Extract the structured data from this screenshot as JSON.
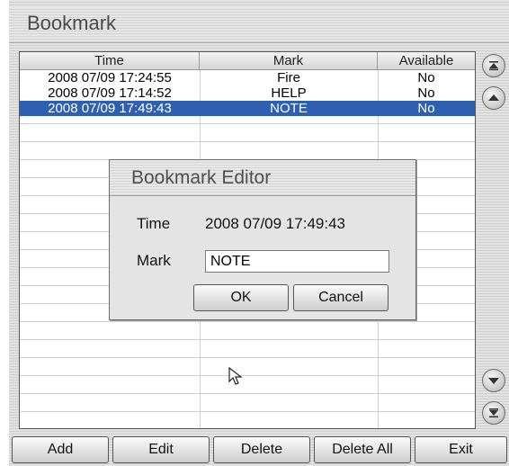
{
  "window": {
    "title": "Bookmark"
  },
  "table": {
    "columns": [
      "Time",
      "Mark",
      "Available"
    ],
    "rows": [
      {
        "time": "2008 07/09 17:24:55",
        "mark": "Fire",
        "available": "No",
        "selected": false
      },
      {
        "time": "2008 07/09 17:14:52",
        "mark": "HELP",
        "available": "No",
        "selected": false
      },
      {
        "time": "2008 07/09 17:49:43",
        "mark": "NOTE",
        "available": "No",
        "selected": true
      }
    ]
  },
  "scroll": {
    "icons": [
      "scroll-top-icon",
      "scroll-up-icon",
      "scroll-down-icon",
      "scroll-bottom-icon"
    ]
  },
  "buttons": {
    "add": "Add",
    "edit": "Edit",
    "delete": "Delete",
    "delete_all": "Delete All",
    "exit": "Exit"
  },
  "dialog": {
    "title": "Bookmark Editor",
    "time_label": "Time",
    "time_value": "2008 07/09 17:49:43",
    "mark_label": "Mark",
    "mark_value": "NOTE",
    "ok": "OK",
    "cancel": "Cancel"
  },
  "colors": {
    "selection": "#2f5fb0",
    "title_text": "#4a4a4a"
  }
}
